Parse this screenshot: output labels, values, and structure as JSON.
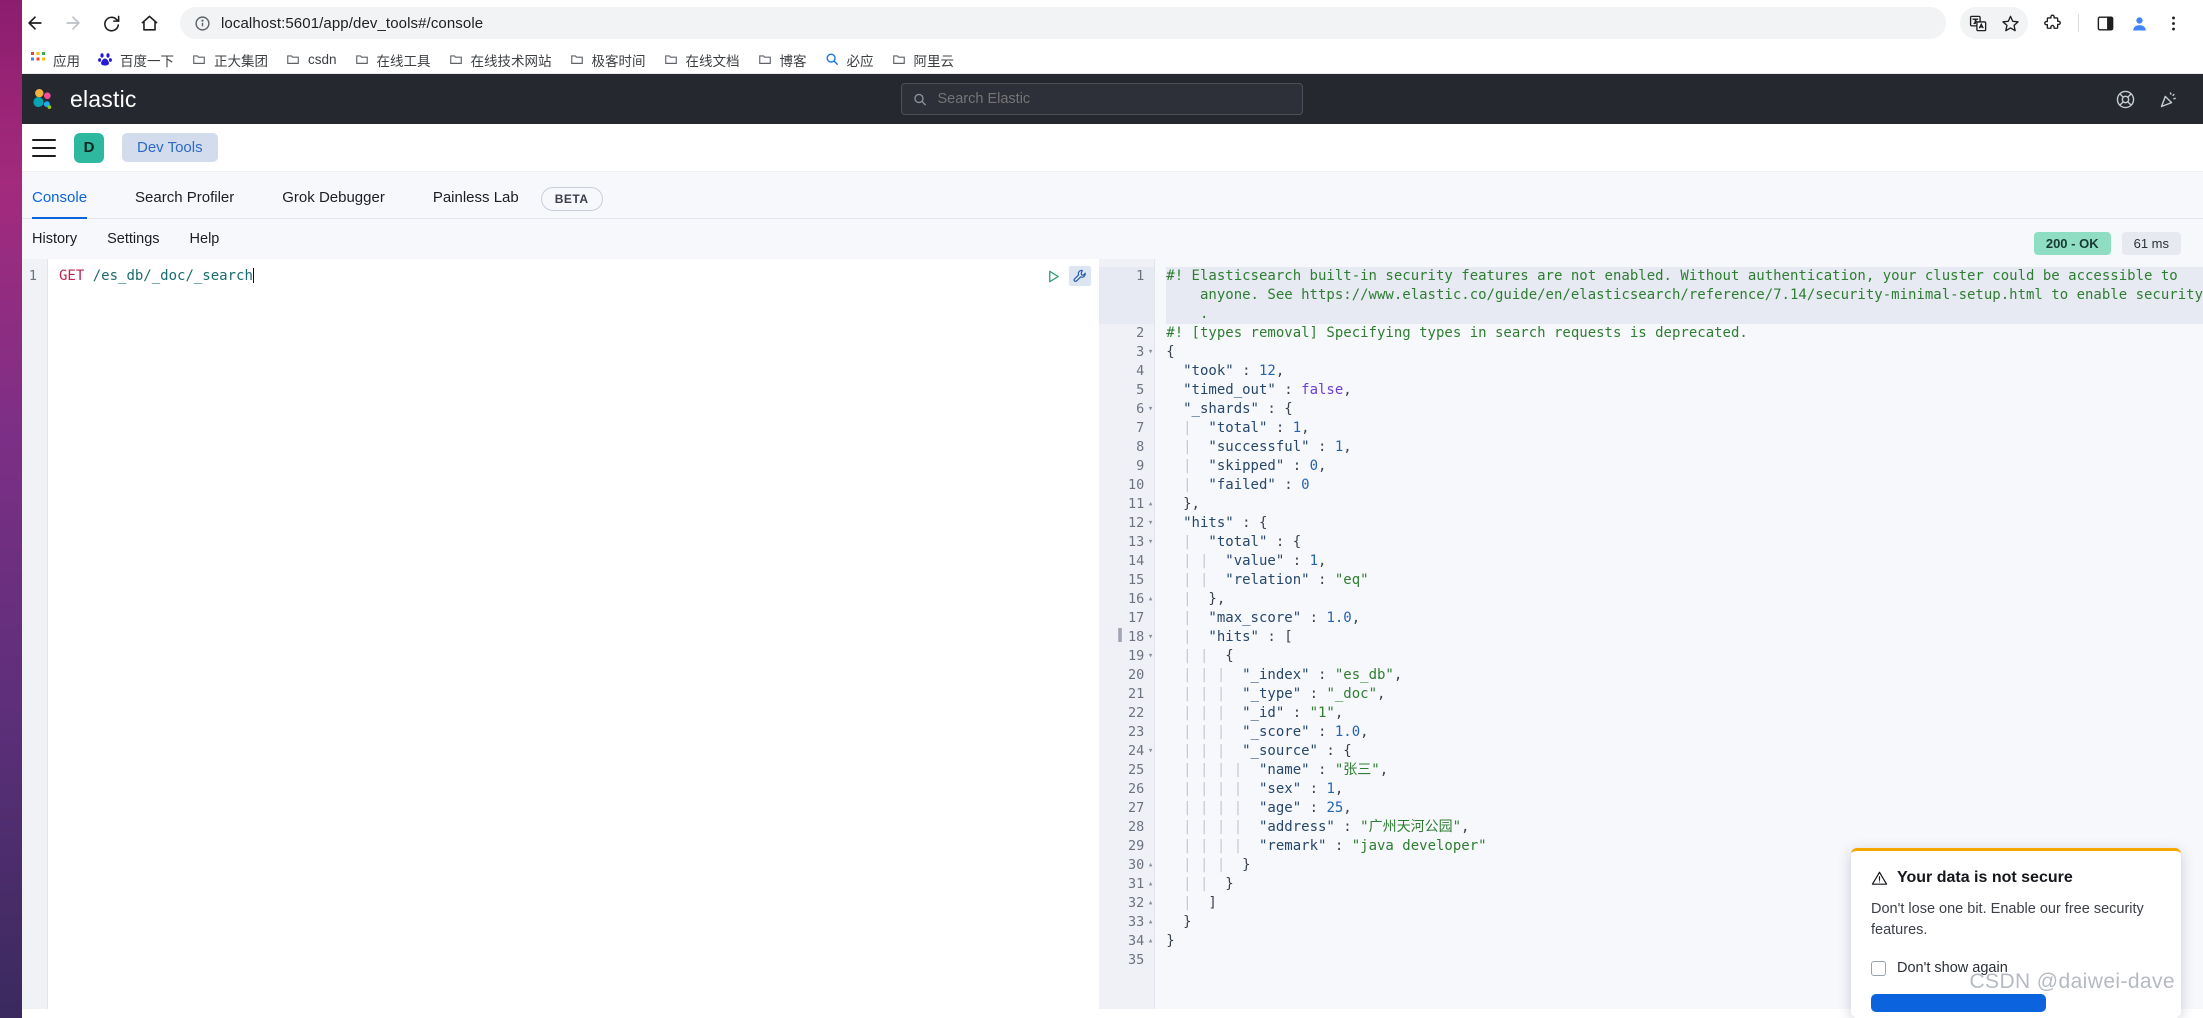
{
  "browser": {
    "url": "localhost:5601/app/dev_tools#/console",
    "nav": {
      "back": "back-arrow",
      "forward": "forward-arrow",
      "reload": "reload",
      "home": "home"
    },
    "bookmarks": [
      {
        "label": "应用",
        "icon": "apps-grid-icon"
      },
      {
        "label": "百度一下",
        "icon": "baidu-icon"
      },
      {
        "label": "正大集团",
        "icon": "folder-icon"
      },
      {
        "label": "csdn",
        "icon": "folder-icon"
      },
      {
        "label": "在线工具",
        "icon": "folder-icon"
      },
      {
        "label": "在线技术网站",
        "icon": "folder-icon"
      },
      {
        "label": "极客时间",
        "icon": "folder-icon"
      },
      {
        "label": "在线文档",
        "icon": "folder-icon"
      },
      {
        "label": "博客",
        "icon": "folder-icon"
      },
      {
        "label": "必应",
        "icon": "bing-search-icon"
      },
      {
        "label": "阿里云",
        "icon": "folder-icon"
      }
    ]
  },
  "elastic_header": {
    "brand": "elastic",
    "search_placeholder": "Search Elastic",
    "search_value": "",
    "icons": [
      "help-lifering-icon",
      "announcements-icon"
    ]
  },
  "nav_row": {
    "menu": "hamburger-menu",
    "space_initial": "D",
    "breadcrumb": "Dev Tools"
  },
  "app_tabs": {
    "tabs": [
      {
        "label": "Console",
        "active": true
      },
      {
        "label": "Search Profiler",
        "active": false
      },
      {
        "label": "Grok Debugger",
        "active": false
      },
      {
        "label": "Painless Lab",
        "active": false
      }
    ],
    "beta_badge": "BETA"
  },
  "console_subnav": {
    "items": [
      "History",
      "Settings",
      "Help"
    ],
    "status_code": "200 - OK",
    "status_time": "61 ms",
    "status_color": "#8fdec4"
  },
  "request_editor": {
    "line_number": "1",
    "method": "GET",
    "path": "/es_db/_doc/_search",
    "actions": [
      "send-request-play-icon",
      "wrench-icon"
    ]
  },
  "response_editor": {
    "lines": [
      {
        "n": "1",
        "fold": "",
        "highlight": true,
        "error": true,
        "tokens": [
          {
            "t": "comment",
            "v": "#! Elasticsearch built-in security features are not enabled. Without authentication, your cluster could be accessible to"
          }
        ]
      },
      {
        "n": "",
        "fold": "",
        "highlight": true,
        "error": false,
        "tokens": [
          {
            "t": "comment",
            "v": "    anyone. See https://www.elastic.co/guide/en/elasticsearch/reference/7.14/security-minimal-setup.html to enable security"
          }
        ]
      },
      {
        "n": "",
        "fold": "",
        "highlight": true,
        "error": false,
        "tokens": [
          {
            "t": "comment",
            "v": "    ."
          }
        ]
      },
      {
        "n": "2",
        "fold": "",
        "highlight": false,
        "error": false,
        "tokens": [
          {
            "t": "comment",
            "v": "#! [types removal] Specifying types in search requests is deprecated."
          }
        ]
      },
      {
        "n": "3",
        "fold": "down",
        "highlight": false,
        "error": false,
        "tokens": [
          {
            "t": "punct",
            "v": "{"
          }
        ]
      },
      {
        "n": "4",
        "fold": "",
        "highlight": false,
        "error": false,
        "tokens": [
          {
            "t": "key",
            "v": "  \"took\""
          },
          {
            "t": "punct",
            "v": " : "
          },
          {
            "t": "num",
            "v": "12"
          },
          {
            "t": "punct",
            "v": ","
          }
        ]
      },
      {
        "n": "5",
        "fold": "",
        "highlight": false,
        "error": false,
        "tokens": [
          {
            "t": "key",
            "v": "  \"timed_out\""
          },
          {
            "t": "punct",
            "v": " : "
          },
          {
            "t": "bool",
            "v": "false"
          },
          {
            "t": "punct",
            "v": ","
          }
        ]
      },
      {
        "n": "6",
        "fold": "down",
        "highlight": false,
        "error": false,
        "tokens": [
          {
            "t": "key",
            "v": "  \"_shards\""
          },
          {
            "t": "punct",
            "v": " : "
          },
          {
            "t": "punct",
            "v": "{"
          }
        ]
      },
      {
        "n": "7",
        "fold": "",
        "highlight": false,
        "error": false,
        "tokens": [
          {
            "t": "guide",
            "v": "  | "
          },
          {
            "t": "key",
            "v": " \"total\""
          },
          {
            "t": "punct",
            "v": " : "
          },
          {
            "t": "num",
            "v": "1"
          },
          {
            "t": "punct",
            "v": ","
          }
        ]
      },
      {
        "n": "8",
        "fold": "",
        "highlight": false,
        "error": false,
        "tokens": [
          {
            "t": "guide",
            "v": "  | "
          },
          {
            "t": "key",
            "v": " \"successful\""
          },
          {
            "t": "punct",
            "v": " : "
          },
          {
            "t": "num",
            "v": "1"
          },
          {
            "t": "punct",
            "v": ","
          }
        ]
      },
      {
        "n": "9",
        "fold": "",
        "highlight": false,
        "error": false,
        "tokens": [
          {
            "t": "guide",
            "v": "  | "
          },
          {
            "t": "key",
            "v": " \"skipped\""
          },
          {
            "t": "punct",
            "v": " : "
          },
          {
            "t": "num",
            "v": "0"
          },
          {
            "t": "punct",
            "v": ","
          }
        ]
      },
      {
        "n": "10",
        "fold": "",
        "highlight": false,
        "error": false,
        "tokens": [
          {
            "t": "guide",
            "v": "  | "
          },
          {
            "t": "key",
            "v": " \"failed\""
          },
          {
            "t": "punct",
            "v": " : "
          },
          {
            "t": "num",
            "v": "0"
          }
        ]
      },
      {
        "n": "11",
        "fold": "up",
        "highlight": false,
        "error": false,
        "tokens": [
          {
            "t": "punct",
            "v": "  },"
          }
        ]
      },
      {
        "n": "12",
        "fold": "down",
        "highlight": false,
        "error": false,
        "tokens": [
          {
            "t": "key",
            "v": "  \"hits\""
          },
          {
            "t": "punct",
            "v": " : "
          },
          {
            "t": "punct",
            "v": "{"
          }
        ]
      },
      {
        "n": "13",
        "fold": "down",
        "highlight": false,
        "error": false,
        "tokens": [
          {
            "t": "guide",
            "v": "  | "
          },
          {
            "t": "key",
            "v": " \"total\""
          },
          {
            "t": "punct",
            "v": " : "
          },
          {
            "t": "punct",
            "v": "{"
          }
        ]
      },
      {
        "n": "14",
        "fold": "",
        "highlight": false,
        "error": false,
        "tokens": [
          {
            "t": "guide",
            "v": "  | | "
          },
          {
            "t": "key",
            "v": " \"value\""
          },
          {
            "t": "punct",
            "v": " : "
          },
          {
            "t": "num",
            "v": "1"
          },
          {
            "t": "punct",
            "v": ","
          }
        ]
      },
      {
        "n": "15",
        "fold": "",
        "highlight": false,
        "error": false,
        "tokens": [
          {
            "t": "guide",
            "v": "  | | "
          },
          {
            "t": "key",
            "v": " \"relation\""
          },
          {
            "t": "punct",
            "v": " : "
          },
          {
            "t": "str",
            "v": "\"eq\""
          }
        ]
      },
      {
        "n": "16",
        "fold": "up",
        "highlight": false,
        "error": false,
        "tokens": [
          {
            "t": "guide",
            "v": "  | "
          },
          {
            "t": "punct",
            "v": " },"
          }
        ]
      },
      {
        "n": "17",
        "fold": "",
        "highlight": false,
        "error": false,
        "tokens": [
          {
            "t": "guide",
            "v": "  | "
          },
          {
            "t": "key",
            "v": " \"max_score\""
          },
          {
            "t": "punct",
            "v": " : "
          },
          {
            "t": "num",
            "v": "1.0"
          },
          {
            "t": "punct",
            "v": ","
          }
        ]
      },
      {
        "n": "18",
        "fold": "down",
        "highlight": false,
        "error": false,
        "tokens": [
          {
            "t": "guide",
            "v": "  | "
          },
          {
            "t": "key",
            "v": " \"hits\""
          },
          {
            "t": "punct",
            "v": " : "
          },
          {
            "t": "punct",
            "v": "["
          }
        ]
      },
      {
        "n": "19",
        "fold": "down",
        "highlight": false,
        "error": false,
        "tokens": [
          {
            "t": "guide",
            "v": "  | | "
          },
          {
            "t": "punct",
            "v": " {"
          }
        ]
      },
      {
        "n": "20",
        "fold": "",
        "highlight": false,
        "error": false,
        "tokens": [
          {
            "t": "guide",
            "v": "  | | | "
          },
          {
            "t": "key",
            "v": " \"_index\""
          },
          {
            "t": "punct",
            "v": " : "
          },
          {
            "t": "str",
            "v": "\"es_db\""
          },
          {
            "t": "punct",
            "v": ","
          }
        ]
      },
      {
        "n": "21",
        "fold": "",
        "highlight": false,
        "error": false,
        "tokens": [
          {
            "t": "guide",
            "v": "  | | | "
          },
          {
            "t": "key",
            "v": " \"_type\""
          },
          {
            "t": "punct",
            "v": " : "
          },
          {
            "t": "str",
            "v": "\"_doc\""
          },
          {
            "t": "punct",
            "v": ","
          }
        ]
      },
      {
        "n": "22",
        "fold": "",
        "highlight": false,
        "error": false,
        "tokens": [
          {
            "t": "guide",
            "v": "  | | | "
          },
          {
            "t": "key",
            "v": " \"_id\""
          },
          {
            "t": "punct",
            "v": " : "
          },
          {
            "t": "str",
            "v": "\"1\""
          },
          {
            "t": "punct",
            "v": ","
          }
        ]
      },
      {
        "n": "23",
        "fold": "",
        "highlight": false,
        "error": false,
        "tokens": [
          {
            "t": "guide",
            "v": "  | | | "
          },
          {
            "t": "key",
            "v": " \"_score\""
          },
          {
            "t": "punct",
            "v": " : "
          },
          {
            "t": "num",
            "v": "1.0"
          },
          {
            "t": "punct",
            "v": ","
          }
        ]
      },
      {
        "n": "24",
        "fold": "down",
        "highlight": false,
        "error": false,
        "tokens": [
          {
            "t": "guide",
            "v": "  | | | "
          },
          {
            "t": "key",
            "v": " \"_source\""
          },
          {
            "t": "punct",
            "v": " : "
          },
          {
            "t": "punct",
            "v": "{"
          }
        ]
      },
      {
        "n": "25",
        "fold": "",
        "highlight": false,
        "error": false,
        "tokens": [
          {
            "t": "guide",
            "v": "  | | | | "
          },
          {
            "t": "key",
            "v": " \"name\""
          },
          {
            "t": "punct",
            "v": " : "
          },
          {
            "t": "str",
            "v": "\"张三\""
          },
          {
            "t": "punct",
            "v": ","
          }
        ]
      },
      {
        "n": "26",
        "fold": "",
        "highlight": false,
        "error": false,
        "tokens": [
          {
            "t": "guide",
            "v": "  | | | | "
          },
          {
            "t": "key",
            "v": " \"sex\""
          },
          {
            "t": "punct",
            "v": " : "
          },
          {
            "t": "num",
            "v": "1"
          },
          {
            "t": "punct",
            "v": ","
          }
        ]
      },
      {
        "n": "27",
        "fold": "",
        "highlight": false,
        "error": false,
        "tokens": [
          {
            "t": "guide",
            "v": "  | | | | "
          },
          {
            "t": "key",
            "v": " \"age\""
          },
          {
            "t": "punct",
            "v": " : "
          },
          {
            "t": "num",
            "v": "25"
          },
          {
            "t": "punct",
            "v": ","
          }
        ]
      },
      {
        "n": "28",
        "fold": "",
        "highlight": false,
        "error": false,
        "tokens": [
          {
            "t": "guide",
            "v": "  | | | | "
          },
          {
            "t": "key",
            "v": " \"address\""
          },
          {
            "t": "punct",
            "v": " : "
          },
          {
            "t": "str",
            "v": "\"广州天河公园\""
          },
          {
            "t": "punct",
            "v": ","
          }
        ]
      },
      {
        "n": "29",
        "fold": "",
        "highlight": false,
        "error": false,
        "tokens": [
          {
            "t": "guide",
            "v": "  | | | | "
          },
          {
            "t": "key",
            "v": " \"remark\""
          },
          {
            "t": "punct",
            "v": " : "
          },
          {
            "t": "str",
            "v": "\"java developer\""
          }
        ]
      },
      {
        "n": "30",
        "fold": "up",
        "highlight": false,
        "error": false,
        "tokens": [
          {
            "t": "guide",
            "v": "  | | | "
          },
          {
            "t": "punct",
            "v": " }"
          }
        ]
      },
      {
        "n": "31",
        "fold": "up",
        "highlight": false,
        "error": false,
        "tokens": [
          {
            "t": "guide",
            "v": "  | | "
          },
          {
            "t": "punct",
            "v": " }"
          }
        ]
      },
      {
        "n": "32",
        "fold": "up",
        "highlight": false,
        "error": false,
        "tokens": [
          {
            "t": "guide",
            "v": "  | "
          },
          {
            "t": "punct",
            "v": " ]"
          }
        ]
      },
      {
        "n": "33",
        "fold": "up",
        "highlight": false,
        "error": false,
        "tokens": [
          {
            "t": "punct",
            "v": "  }"
          }
        ]
      },
      {
        "n": "34",
        "fold": "up",
        "highlight": false,
        "error": false,
        "tokens": [
          {
            "t": "punct",
            "v": "}"
          }
        ]
      },
      {
        "n": "35",
        "fold": "",
        "highlight": false,
        "error": false,
        "tokens": []
      }
    ]
  },
  "toast": {
    "title": "Your data is not secure",
    "body": "Don't lose one bit. Enable our free security features.",
    "checkbox_label": "Don't show again",
    "button_label": "",
    "accent_color": "#f5a700",
    "warning_icon": "warning-triangle-icon"
  },
  "watermark": "CSDN @daiwei-dave"
}
